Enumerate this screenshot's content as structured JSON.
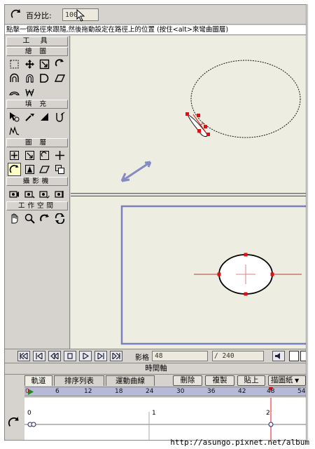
{
  "optbar": {
    "percent_label": "百分比:",
    "percent_value": "100"
  },
  "hint": "點擊一個路徑來跟隨,然後拖動設定在路徑上的位置 (按住<alt>來彎曲圖層)",
  "toolbox": {
    "title": "工 具",
    "sections": {
      "draw": "繪 圖",
      "fill": "填 充",
      "layer": "圖 層",
      "camera": "攝影機",
      "workspace": "工作空間"
    }
  },
  "playbar": {
    "frame_label": "影格",
    "frame_value": "48",
    "total_value": "/ 240"
  },
  "timeline": {
    "title": "時間軸",
    "tabs": [
      "軌道",
      "排序列表",
      "運動曲線"
    ],
    "buttons": [
      "刪除",
      "複製",
      "貼上",
      "描圖紙"
    ],
    "ruler": [
      "0",
      "6",
      "12",
      "18",
      "24",
      "30",
      "36",
      "42",
      "48",
      "54"
    ],
    "track_ticks": [
      "0",
      "1",
      "2"
    ]
  },
  "watermark": "http://asungo.pixnet.net/album",
  "colors": {
    "canvas": "#eeede1",
    "accent": "#7b7fc0",
    "handle": "#e01010",
    "ruler": "#b7bad6"
  }
}
